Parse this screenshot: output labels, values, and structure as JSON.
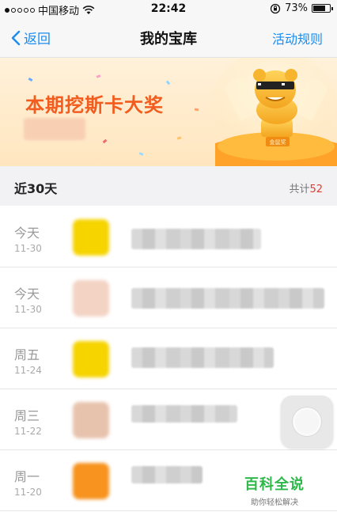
{
  "status_bar": {
    "carrier": "中国移动",
    "time": "22:42",
    "battery": "73%",
    "battery_level": 0.73,
    "wifi_icon": "wifi-icon",
    "lock_icon": "orientation-lock-icon"
  },
  "nav": {
    "back_label": "返回",
    "title": "我的宝库",
    "rules_label": "活动规则",
    "accent": "#1a8cf0"
  },
  "banner": {
    "headline": "本期挖斯卡大奖",
    "trophy_label": "金鼠奖",
    "accent": "#f25c1e"
  },
  "section": {
    "title": "近30天",
    "count_prefix": "共计",
    "count": "52",
    "count_color": "#e23a2e"
  },
  "records": [
    {
      "day": "今天",
      "date": "11-30",
      "thumb_color": "#f6d400"
    },
    {
      "day": "今天",
      "date": "11-30",
      "thumb_color": "#f3d3c4"
    },
    {
      "day": "周五",
      "date": "11-24",
      "thumb_color": "#f6d400"
    },
    {
      "day": "周三",
      "date": "11-22",
      "thumb_color": "#e7c3ad"
    },
    {
      "day": "周一",
      "date": "11-20",
      "thumb_color": "#f7931e"
    }
  ],
  "watermark": {
    "main": "百科全说",
    "sub": "助你轻松解决",
    "color": "#2eb84a"
  }
}
